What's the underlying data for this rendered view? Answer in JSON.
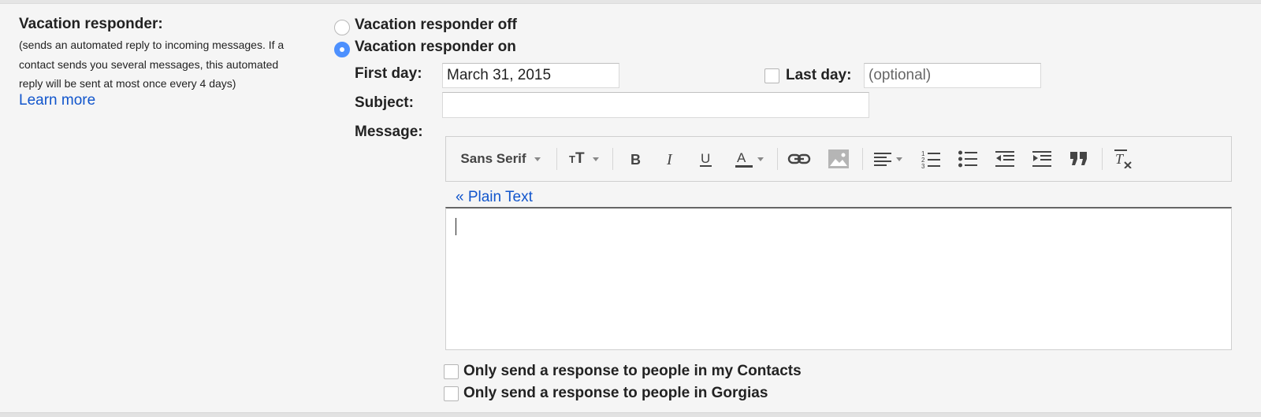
{
  "section": {
    "title": "Vacation responder:",
    "description": "(sends an automated reply to incoming messages. If a contact sends you several messages, this automated reply will be sent at most once every 4 days)",
    "learn_more": "Learn more"
  },
  "responder": {
    "off_label": "Vacation responder off",
    "on_label": "Vacation responder on",
    "selected": "on"
  },
  "fields": {
    "first_day_label": "First day:",
    "first_day_value": "March 31, 2015",
    "last_day_label": "Last day:",
    "last_day_placeholder": "(optional)",
    "last_day_checked": false,
    "subject_label": "Subject:",
    "subject_value": "",
    "message_label": "Message:"
  },
  "toolbar": {
    "font": "Sans Serif",
    "icons": [
      "text-size-icon",
      "bold-icon",
      "italic-icon",
      "underline-icon",
      "text-color-icon",
      "link-icon",
      "image-icon",
      "align-icon",
      "numbered-list-icon",
      "bulleted-list-icon",
      "indent-less-icon",
      "indent-more-icon",
      "quote-icon",
      "remove-formatting-icon"
    ]
  },
  "editor": {
    "plain_text_link": "« Plain Text",
    "body": ""
  },
  "options": {
    "contacts_only": "Only send a response to people in my Contacts",
    "domain_only": "Only send a response to people in Gorgias"
  },
  "colors": {
    "link": "#1155cc",
    "radio_selected": "#4d90fe",
    "background": "#f5f5f5"
  }
}
